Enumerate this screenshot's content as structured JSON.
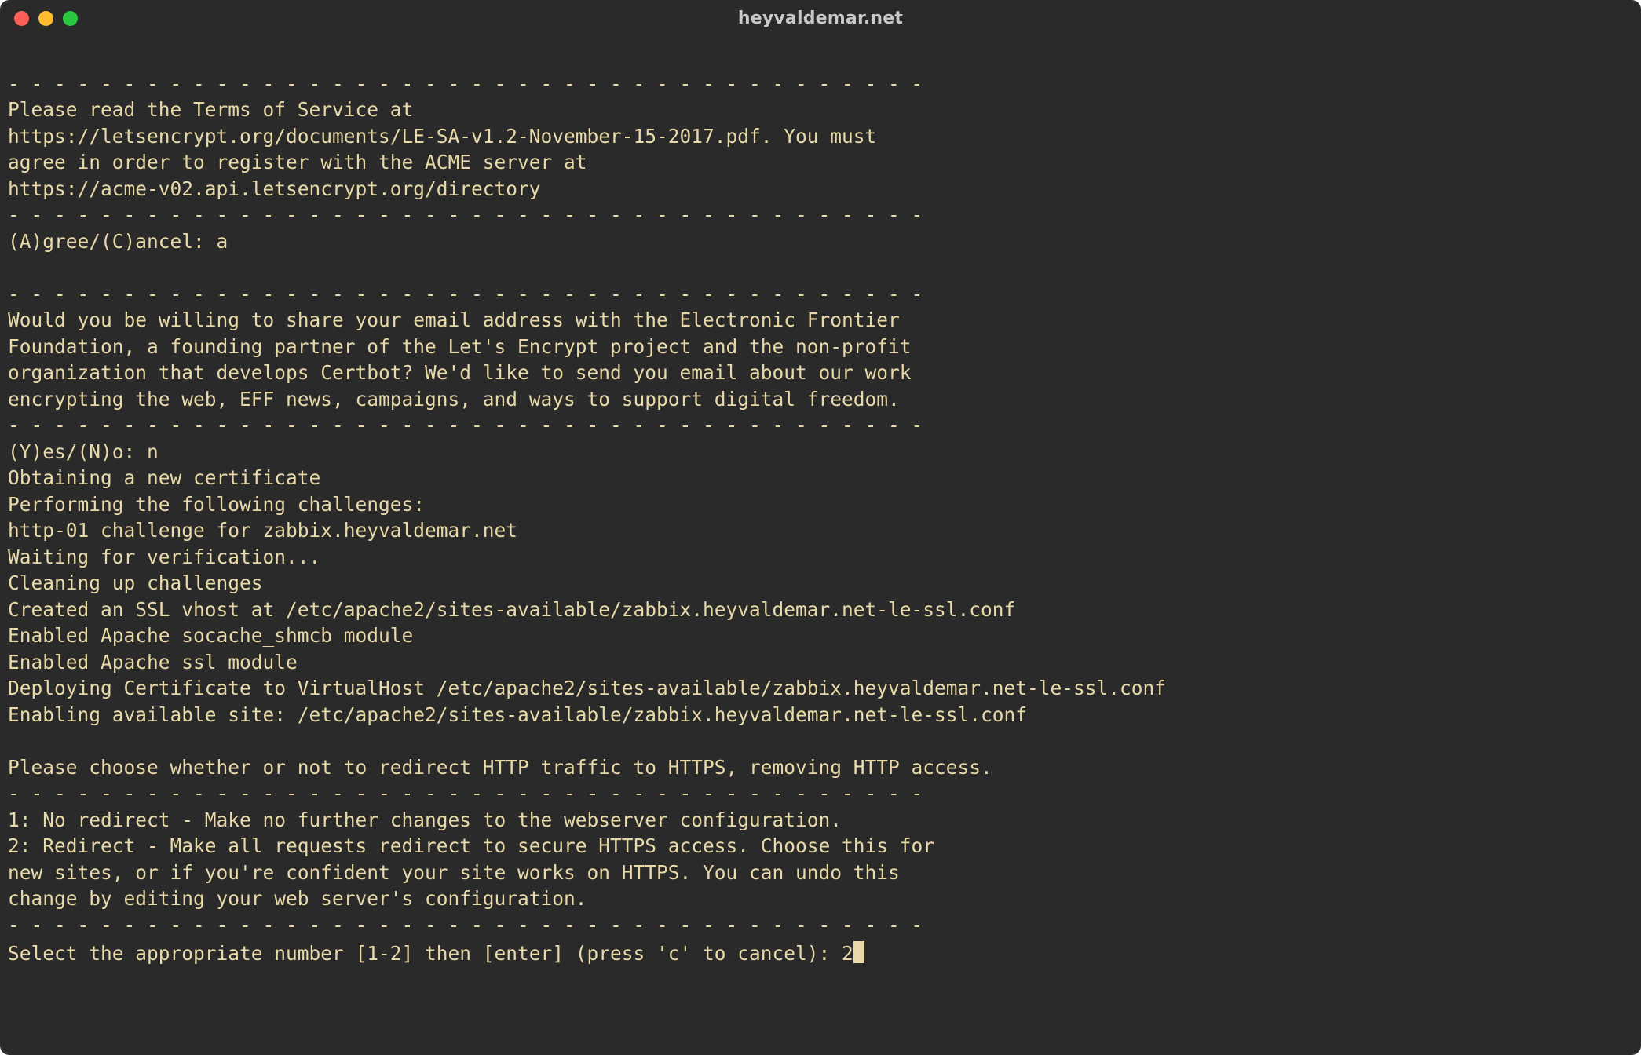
{
  "window": {
    "title": "heyvaldemar.net"
  },
  "terminal": {
    "lines": [
      "",
      "- - - - - - - - - - - - - - - - - - - - - - - - - - - - - - - - - - - - - - - -",
      "Please read the Terms of Service at",
      "https://letsencrypt.org/documents/LE-SA-v1.2-November-15-2017.pdf. You must",
      "agree in order to register with the ACME server at",
      "https://acme-v02.api.letsencrypt.org/directory",
      "- - - - - - - - - - - - - - - - - - - - - - - - - - - - - - - - - - - - - - - -",
      "(A)gree/(C)ancel: a",
      "",
      "- - - - - - - - - - - - - - - - - - - - - - - - - - - - - - - - - - - - - - - -",
      "Would you be willing to share your email address with the Electronic Frontier",
      "Foundation, a founding partner of the Let's Encrypt project and the non-profit",
      "organization that develops Certbot? We'd like to send you email about our work",
      "encrypting the web, EFF news, campaigns, and ways to support digital freedom.",
      "- - - - - - - - - - - - - - - - - - - - - - - - - - - - - - - - - - - - - - - -",
      "(Y)es/(N)o: n",
      "Obtaining a new certificate",
      "Performing the following challenges:",
      "http-01 challenge for zabbix.heyvaldemar.net",
      "Waiting for verification...",
      "Cleaning up challenges",
      "Created an SSL vhost at /etc/apache2/sites-available/zabbix.heyvaldemar.net-le-ssl.conf",
      "Enabled Apache socache_shmcb module",
      "Enabled Apache ssl module",
      "Deploying Certificate to VirtualHost /etc/apache2/sites-available/zabbix.heyvaldemar.net-le-ssl.conf",
      "Enabling available site: /etc/apache2/sites-available/zabbix.heyvaldemar.net-le-ssl.conf",
      "",
      "Please choose whether or not to redirect HTTP traffic to HTTPS, removing HTTP access.",
      "- - - - - - - - - - - - - - - - - - - - - - - - - - - - - - - - - - - - - - - -",
      "1: No redirect - Make no further changes to the webserver configuration.",
      "2: Redirect - Make all requests redirect to secure HTTPS access. Choose this for",
      "new sites, or if you're confident your site works on HTTPS. You can undo this",
      "change by editing your web server's configuration.",
      "- - - - - - - - - - - - - - - - - - - - - - - - - - - - - - - - - - - - - - - -"
    ],
    "prompt": "Select the appropriate number [1-2] then [enter] (press 'c' to cancel): ",
    "input": "2"
  }
}
